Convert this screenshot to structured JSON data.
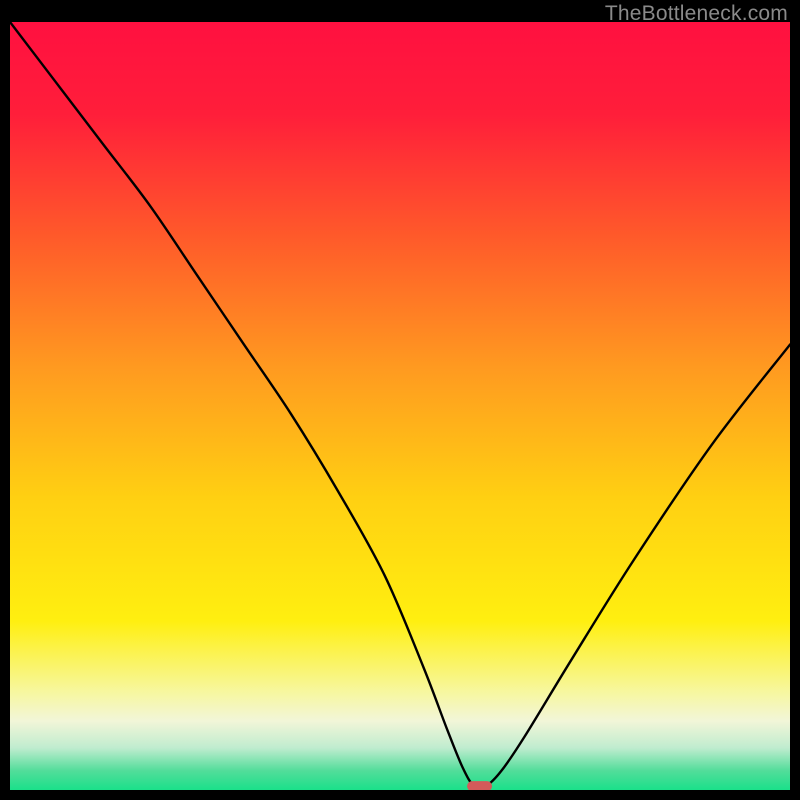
{
  "watermark": "TheBottleneck.com",
  "chart_data": {
    "type": "line",
    "title": "",
    "xlabel": "",
    "ylabel": "",
    "xlim": [
      0,
      100
    ],
    "ylim": [
      0,
      100
    ],
    "grid": false,
    "legend": false,
    "background_gradient": {
      "stops": [
        {
          "offset": 0.0,
          "color": "#ff1040"
        },
        {
          "offset": 0.12,
          "color": "#ff1e3a"
        },
        {
          "offset": 0.28,
          "color": "#ff5a2a"
        },
        {
          "offset": 0.45,
          "color": "#ff9a20"
        },
        {
          "offset": 0.62,
          "color": "#ffd012"
        },
        {
          "offset": 0.78,
          "color": "#ffef10"
        },
        {
          "offset": 0.87,
          "color": "#f7f79c"
        },
        {
          "offset": 0.91,
          "color": "#f2f6d8"
        },
        {
          "offset": 0.945,
          "color": "#c0eccf"
        },
        {
          "offset": 0.975,
          "color": "#52dd9a"
        },
        {
          "offset": 1.0,
          "color": "#1ae08a"
        }
      ]
    },
    "series": [
      {
        "name": "bottleneck-curve",
        "color": "#000000",
        "x": [
          0,
          6,
          12,
          18,
          24,
          30,
          36,
          42,
          48,
          53,
          56,
          58,
          59.5,
          61,
          63,
          66,
          72,
          80,
          90,
          100
        ],
        "y": [
          100,
          92,
          84,
          76,
          67,
          58,
          49,
          39,
          28,
          16,
          8,
          3,
          0.5,
          0.5,
          2.5,
          7,
          17,
          30,
          45,
          58
        ]
      }
    ],
    "marker": {
      "name": "optimum-marker",
      "x": 60.2,
      "y": 0.5,
      "color": "#d45a5a",
      "width": 3.2,
      "height": 1.3
    }
  }
}
